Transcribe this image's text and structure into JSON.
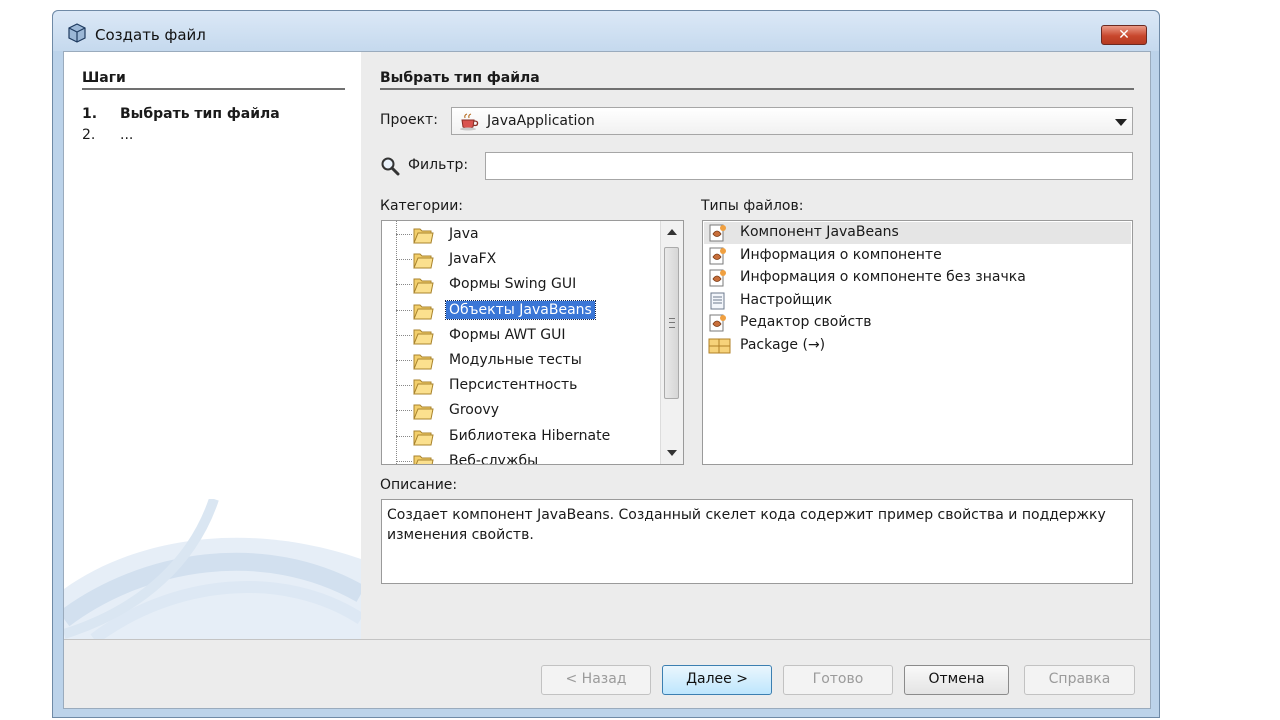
{
  "window": {
    "title": "Создать файл",
    "close_label": "✕"
  },
  "steps": {
    "title": "Шаги",
    "items": [
      {
        "num": "1.",
        "label": "Выбрать тип файла"
      },
      {
        "num": "2.",
        "label": "..."
      }
    ]
  },
  "main": {
    "title": "Выбрать тип файла",
    "project_label": "Проект:",
    "project_value": "JavaApplication",
    "filter_label": "Фильтр:",
    "filter_value": "",
    "categories_label": "Категории:",
    "categories": [
      "Java",
      "JavaFX",
      "Формы Swing GUI",
      "Объекты JavaBeans",
      "Формы AWT GUI",
      "Модульные тесты",
      "Персистентность",
      "Groovy",
      "Библиотека Hibernate",
      "Веб-службы"
    ],
    "selected_category": "Объекты JavaBeans",
    "file_types_label": "Типы файлов:",
    "file_types": [
      "Компонент JavaBeans",
      "Информация о компоненте",
      "Информация о компоненте без значка",
      "Настройщик",
      "Редактор свойств",
      "Package (→)"
    ],
    "selected_file_type": "Компонент JavaBeans",
    "description_label": "Описание:",
    "description": "Создает компонент JavaBeans. Созданный скелет кода содержит пример свойства и поддержку изменения свойств."
  },
  "buttons": {
    "back": "< Назад",
    "next": "Далее >",
    "finish": "Готово",
    "cancel": "Отмена",
    "help": "Справка"
  },
  "colors": {
    "selection": "#3a76d6",
    "window_frame": "#bcd3ea",
    "close_button": "#c8472d"
  }
}
